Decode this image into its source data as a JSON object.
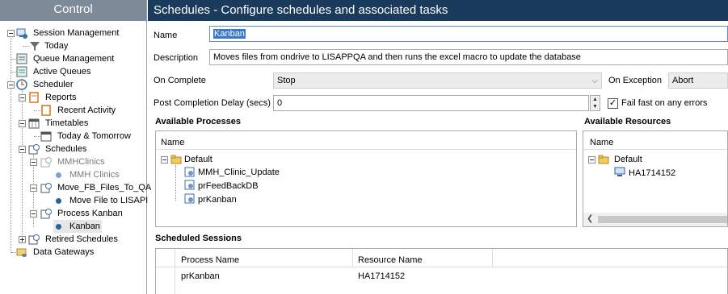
{
  "left_panel": {
    "title": "Control",
    "tree": {
      "session_management": "Session Management",
      "today": "Today",
      "queue_management": "Queue Management",
      "active_queues": "Active Queues",
      "scheduler": "Scheduler",
      "reports": "Reports",
      "recent_activity": "Recent Activity",
      "timetables": "Timetables",
      "today_tomorrow": "Today & Tomorrow",
      "schedules": "Schedules",
      "mmhclinics": "MMHClinics",
      "mmh_clinics": "MMH Clinics",
      "move_fb": "Move_FB_Files_To_QA",
      "move_file": "Move File to LISAPI",
      "process_kanban": "Process Kanban",
      "kanban": "Kanban",
      "retired_schedules": "Retired Schedules",
      "data_gateways": "Data Gateways"
    }
  },
  "header": {
    "title": "Schedules - Configure schedules and associated tasks"
  },
  "form": {
    "name_label": "Name",
    "name_value": "Kanban",
    "description_label": "Description",
    "description_value": "Moves files from ondrive to LISAPPQA and then runs the excel macro to update the database",
    "on_complete_label": "On Complete",
    "on_complete_value": "Stop",
    "on_exception_label": "On Exception",
    "on_exception_value": "Abort",
    "post_delay_label": "Post Completion Delay (secs)",
    "post_delay_value": "0",
    "fail_fast_label": "Fail fast on any errors",
    "fail_fast_checked": true
  },
  "available_processes": {
    "title": "Available Processes",
    "column": "Name",
    "group": "Default",
    "items": [
      "MMH_Clinic_Update",
      "prFeedBackDB",
      "prKanban"
    ]
  },
  "available_resources": {
    "title": "Available Resources",
    "column": "Name",
    "group": "Default",
    "items": [
      "HA1714152"
    ]
  },
  "scheduled_sessions": {
    "title": "Scheduled Sessions",
    "columns": [
      "Process Name",
      "Resource Name"
    ],
    "rows": [
      [
        "prKanban",
        "HA1714152"
      ]
    ]
  },
  "colors": {
    "title_bar": "#1b3b5c",
    "left_header": "#7d8a98",
    "selection": "#3a78c7"
  }
}
